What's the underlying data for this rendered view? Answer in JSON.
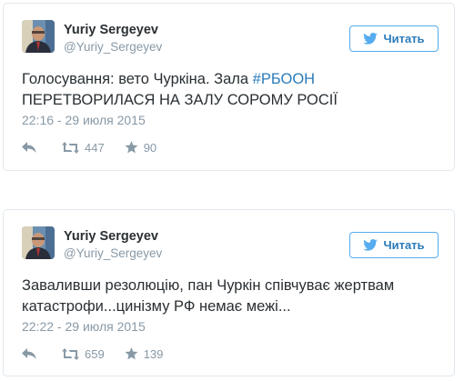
{
  "tweets": [
    {
      "name": "Yuriy Sergeyev",
      "handle": "@Yuriy_Sergeyev",
      "follow_label": "Читать",
      "text_before": "Голосування: вето Чуркіна. Зала ",
      "hashtag": "#РБООН",
      "text_after": "ПЕРЕТВОРИЛАСЯ НА ЗАЛУ СОРОМУ РОСІЇ",
      "time": "22:16 - 29 июля 2015",
      "retweets": "447",
      "likes": "90"
    },
    {
      "name": "Yuriy Sergeyev",
      "handle": "@Yuriy_Sergeyev",
      "follow_label": "Читать",
      "text_line1": "Заваливши резолюцію, пан Чуркін співчуває жертвам",
      "text_line2": "катастрофи...цинізму РФ немає межі...",
      "time": "22:22 - 29 июля 2015",
      "retweets": "659",
      "likes": "139"
    }
  ],
  "icons": {
    "bird": "twitter-bird-icon",
    "reply": "reply-icon",
    "retweet": "retweet-icon",
    "like": "star-icon"
  },
  "colors": {
    "link": "#2b7bb9",
    "button_border": "#55acee",
    "muted": "#8899a6",
    "text": "#292f33",
    "card_border": "#e1e8ed"
  }
}
